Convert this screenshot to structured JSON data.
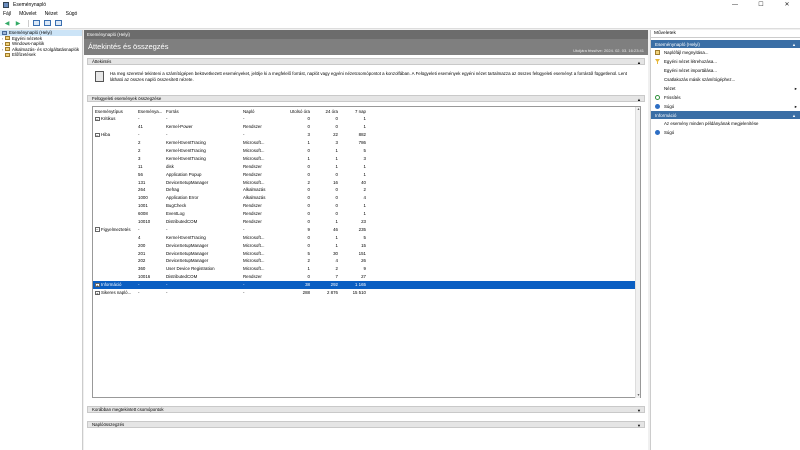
{
  "window": {
    "title": "Eseménynapló",
    "minimize": "—",
    "maximize": "☐",
    "close": "✕"
  },
  "menu": [
    "Fájl",
    "Művelet",
    "Nézet",
    "Súgó"
  ],
  "tree": {
    "root": "Eseménynapló (Helyi)",
    "items": [
      "Egyéni nézetek",
      "Windows-naplók",
      "Alkalmazás- és szolgáltatásnaplók",
      "Előfizetések"
    ]
  },
  "center": {
    "header": "Eseménynapló (Helyi)",
    "banner_title": "Áttekintés és összegzés",
    "banner_date": "Utoljára frissítve: 2024. 02. 03. 16:23:41",
    "overview_label": "Áttekintés",
    "overview_text": "Ha meg szeretné tekinteni a számítógépen bekövetkezett eseményeket, jelölje ki a megfelelő forrást, naplót vagy egyéni nézetcsomópontot a konzolfában. A Felügyeleti események egyéni nézet tartalmazza az összes felügyeleti eseményt a forrástól függetlenül. Lent látható az összes napló összesített nézete.",
    "summary_label": "Felügyeleti események összegzése",
    "recent_label": "Korábban megtekintett csomópontok",
    "logsummary_label": "Naplóösszegzés"
  },
  "table": {
    "headers": [
      "Eseménytípus",
      "Eseménya...",
      "Forrás",
      "Napló",
      "Utolsó óra",
      "24 óra",
      "7 nap"
    ],
    "rows": [
      {
        "c": [
          "Kritikus",
          "-",
          "-",
          "-",
          "0",
          "0",
          "1"
        ],
        "pm": "−",
        "level": 0
      },
      {
        "c": [
          "",
          "41",
          "Kernel-Power",
          "Rendszer",
          "0",
          "0",
          "1"
        ],
        "level": 1
      },
      {
        "c": [
          "Hiba",
          "-",
          "-",
          "-",
          "3",
          "22",
          "882"
        ],
        "pm": "−",
        "level": 0
      },
      {
        "c": [
          "",
          "2",
          "Kernel-EventTracing",
          "Microsoft...",
          "1",
          "3",
          "786"
        ],
        "level": 1
      },
      {
        "c": [
          "",
          "2",
          "Kernel-EventTracing",
          "Microsoft...",
          "0",
          "1",
          "5"
        ],
        "level": 1
      },
      {
        "c": [
          "",
          "3",
          "Kernel-EventTracing",
          "Microsoft...",
          "1",
          "1",
          "3"
        ],
        "level": 1
      },
      {
        "c": [
          "",
          "11",
          "disk",
          "Rendszer",
          "0",
          "1",
          "1"
        ],
        "level": 1
      },
      {
        "c": [
          "",
          "56",
          "Application Popup",
          "Rendszer",
          "0",
          "0",
          "1"
        ],
        "level": 1
      },
      {
        "c": [
          "",
          "131",
          "DeviceSetupManager",
          "Microsoft...",
          "2",
          "16",
          "40"
        ],
        "level": 1
      },
      {
        "c": [
          "",
          "264",
          "Defrag",
          "Alkalmazás",
          "0",
          "0",
          "2"
        ],
        "level": 1
      },
      {
        "c": [
          "",
          "1000",
          "Application Error",
          "Alkalmazás",
          "0",
          "0",
          "4"
        ],
        "level": 1
      },
      {
        "c": [
          "",
          "1001",
          "BugCheck",
          "Rendszer",
          "0",
          "0",
          "1"
        ],
        "level": 1
      },
      {
        "c": [
          "",
          "6008",
          "EventLog",
          "Rendszer",
          "0",
          "0",
          "1"
        ],
        "level": 1
      },
      {
        "c": [
          "",
          "10010",
          "DistributedCOM",
          "Rendszer",
          "0",
          "1",
          "23"
        ],
        "level": 1
      },
      {
        "c": [
          "Figyelmeztetés",
          "-",
          "-",
          "-",
          "9",
          "46",
          "235"
        ],
        "pm": "−",
        "level": 0
      },
      {
        "c": [
          "",
          "4",
          "Kernel-EventTracing",
          "Microsoft...",
          "0",
          "1",
          "5"
        ],
        "level": 1
      },
      {
        "c": [
          "",
          "200",
          "DeviceSetupManager",
          "Microsoft...",
          "0",
          "1",
          "15"
        ],
        "level": 1
      },
      {
        "c": [
          "",
          "201",
          "DeviceSetupManager",
          "Microsoft...",
          "5",
          "30",
          "151"
        ],
        "level": 1
      },
      {
        "c": [
          "",
          "202",
          "DeviceSetupManager",
          "Microsoft...",
          "2",
          "4",
          "26"
        ],
        "level": 1
      },
      {
        "c": [
          "",
          "360",
          "User Device Registration",
          "Microsoft...",
          "1",
          "2",
          "9"
        ],
        "level": 1
      },
      {
        "c": [
          "",
          "10016",
          "DistributedCOM",
          "Rendszer",
          "0",
          "7",
          "27"
        ],
        "level": 1
      },
      {
        "c": [
          "Információ",
          "-",
          "-",
          "-",
          "38",
          "292",
          "1 165"
        ],
        "pm": "+",
        "level": 0,
        "selected": true
      },
      {
        "c": [
          "Sikeres napló...",
          "-",
          "-",
          "-",
          "288",
          "2 876",
          "15 510"
        ],
        "pm": "+",
        "level": 0
      }
    ]
  },
  "actions": {
    "header": "Műveletek",
    "section1": "Eseménynapló (Helyi)",
    "items1": [
      {
        "label": "Naplófájl megnyitása...",
        "icon": "folder-icon"
      },
      {
        "label": "Egyéni nézet létrehozása...",
        "icon": "filter-icon"
      },
      {
        "label": "Egyéni nézet importálása...",
        "icon": ""
      },
      {
        "label": "Csatlakozás másik számítógéphez...",
        "icon": ""
      },
      {
        "label": "Nézet",
        "icon": "",
        "submenu": true
      },
      {
        "label": "Frissítés",
        "icon": "refresh-icon"
      },
      {
        "label": "Súgó",
        "icon": "help-icon",
        "submenu": true
      }
    ],
    "section2": "Információ",
    "items2": [
      {
        "label": "Az esemény minden példányának megjelenítése",
        "icon": ""
      },
      {
        "label": "Súgó",
        "icon": "help-icon"
      }
    ]
  },
  "colors": {
    "selection": "#0a5ec2",
    "banner": "#7f7f7f",
    "action_section": "#3a6ea5"
  }
}
